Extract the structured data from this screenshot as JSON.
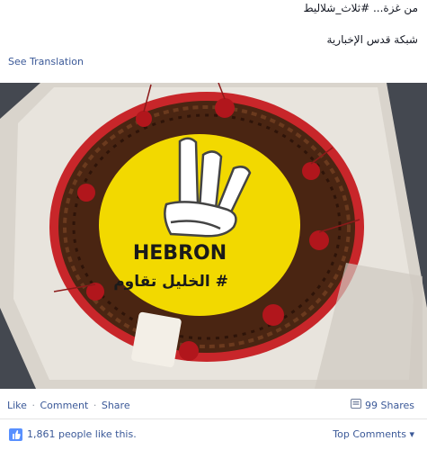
{
  "post": {
    "text": "من غزة... #ثلاث_شلاليط",
    "shared_from": "شبكة قدس الإخبارية",
    "translate": "See Translation"
  },
  "photo": {
    "cake_text_en": "HEBRON",
    "cake_text_ar": "# الخليل تقاوم"
  },
  "actions": {
    "like": "Like",
    "sep1": "·",
    "comment": "Comment",
    "sep2": "·",
    "share": "Share",
    "shares_count": "99 Shares"
  },
  "likes": {
    "text": "1,861 people like this."
  },
  "comments": {
    "sort": "Top Comments ▾"
  },
  "icons": {
    "share": "share-icon",
    "like": "thumbs-up-icon"
  },
  "colors": {
    "link": "#3b5998",
    "text": "#141823",
    "cake_yellow": "#f2d900",
    "chocolate": "#4a2512"
  }
}
